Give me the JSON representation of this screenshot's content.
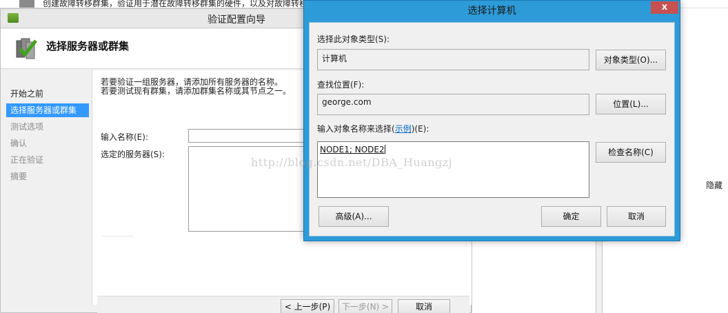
{
  "background_window": {
    "description_line": "创建故障转移群集，验证用于潜在故障转移群集的硬件，以及对故障转移"
  },
  "wizard": {
    "title": "验证配置向导",
    "header_title": "选择服务器或群集",
    "nav": [
      "开始之前",
      "选择服务器或群集",
      "测试选项",
      "确认",
      "正在验证",
      "摘要"
    ],
    "description_line1": "若要验证一组服务器，请添加所有服务器的名称。",
    "description_line2": "若要测试现有群集，请添加群集名称或其节点之一。",
    "name_label": "输入名称(E):",
    "servers_label": "选定的服务器(S):",
    "back_button": "< 上一步(P)",
    "next_button": "下一步(N) >",
    "cancel_button": "取消"
  },
  "right_panel": {
    "hide_label": "隐藏"
  },
  "dialog": {
    "title": "选择计算机",
    "close_glyph": "x",
    "object_type_label": "选择此对象类型(S):",
    "object_type_value": "计算机",
    "object_types_button": "对象类型(O)...",
    "location_label": "查找位置(F):",
    "location_value": "george.com",
    "location_button": "位置(L)...",
    "names_label_prefix": "输入对象名称来选择(",
    "names_label_link": "示例",
    "names_label_suffix": ")(E):",
    "names_value": "NODE1; NODE2",
    "check_names_button": "检查名称(C)",
    "advanced_button": "高级(A)...",
    "ok_button": "确定",
    "cancel_button": "取消"
  },
  "watermark": "http://blog.csdn.net/DBA_Huangzj",
  "colors": {
    "dialog_frame": "#2d9bd8",
    "close_button": "#c75050",
    "nav_selected": "#3399ff",
    "link": "#0066cc"
  },
  "icons": {
    "app": "wizard-app-icon",
    "header": "server-checkmark-icon",
    "close": "close-icon"
  }
}
